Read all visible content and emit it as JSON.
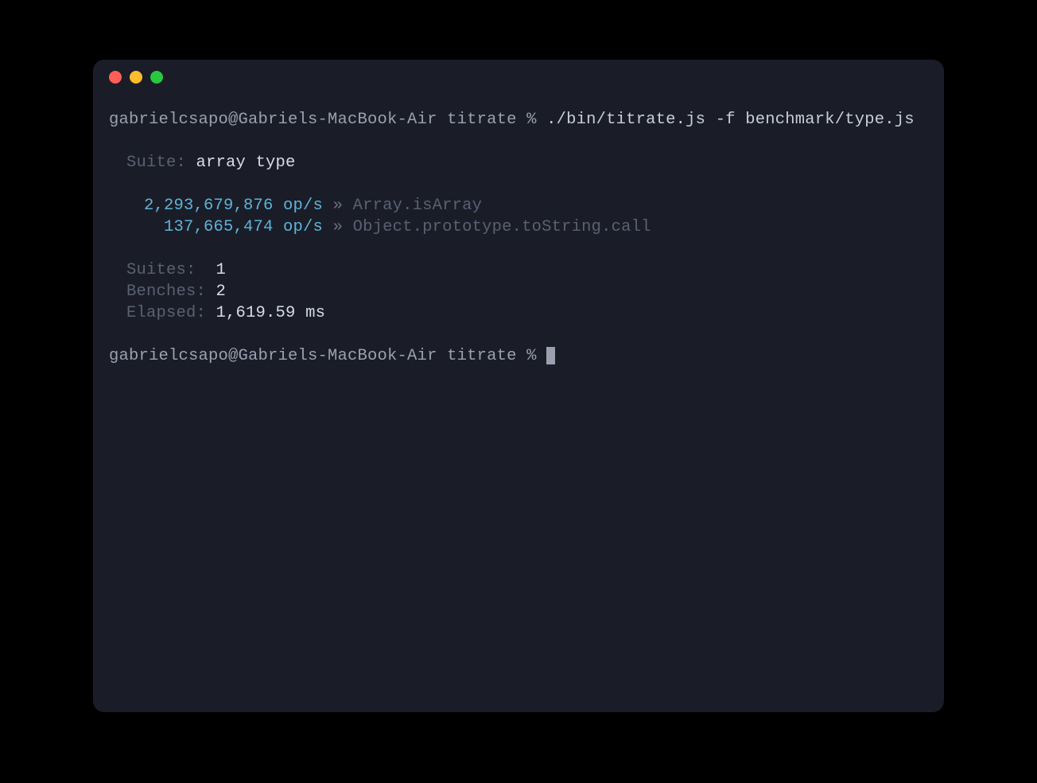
{
  "prompt1": {
    "userhost": "gabrielcsapo@Gabriels-MacBook-Air",
    "cwd": "titrate",
    "symbol": "%",
    "command": "./bin/titrate.js -f benchmark/type.js"
  },
  "suite": {
    "label": "Suite:",
    "name": "array type"
  },
  "benches": [
    {
      "ops": "2,293,679,876 op/s",
      "sep": "»",
      "name": "Array.isArray"
    },
    {
      "ops": "137,665,474 op/s",
      "sep": "»",
      "name": "Object.prototype.toString.call"
    }
  ],
  "summary": {
    "suites_label": "Suites:",
    "suites_value": "1",
    "benches_label": "Benches:",
    "benches_value": "2",
    "elapsed_label": "Elapsed:",
    "elapsed_value": "1,619.59 ms"
  },
  "prompt2": {
    "userhost": "gabrielcsapo@Gabriels-MacBook-Air",
    "cwd": "titrate",
    "symbol": "%"
  },
  "colors": {
    "close": "#ff5f57",
    "minimize": "#febc2e",
    "maximize": "#28c840",
    "bg": "#1a1d27",
    "cyan": "#5fb3d9"
  }
}
